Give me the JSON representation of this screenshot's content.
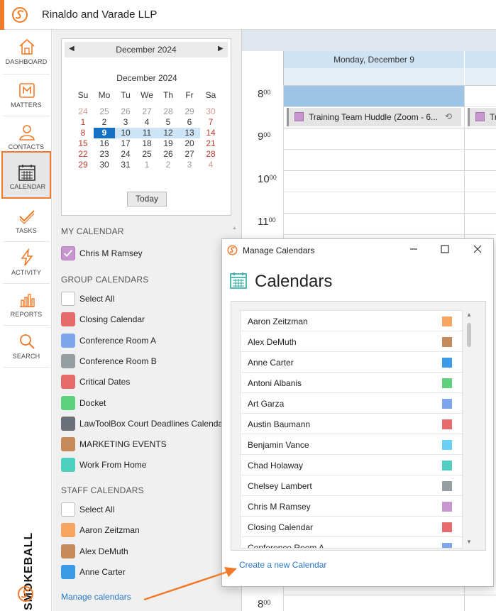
{
  "app": {
    "firm_name": "Rinaldo and Varade LLP",
    "brand_text": "SMOKEBALL",
    "accent_color": "#f07a28",
    "link_color": "#2a77c9"
  },
  "nav": {
    "items": [
      {
        "label": "DASHBOARD",
        "icon": "home-icon"
      },
      {
        "label": "MATTERS",
        "icon": "matters-icon"
      },
      {
        "label": "CONTACTS",
        "icon": "contacts-icon"
      },
      {
        "label": "CALENDAR",
        "icon": "calendar-icon",
        "active": true
      },
      {
        "label": "TASKS",
        "icon": "tasks-icon"
      },
      {
        "label": "ACTIVITY",
        "icon": "activity-icon"
      },
      {
        "label": "REPORTS",
        "icon": "reports-icon"
      },
      {
        "label": "SEARCH",
        "icon": "search-icon"
      }
    ]
  },
  "mini_calendar": {
    "header_title": "December 2024",
    "month_title": "December 2024",
    "weekdays": [
      "Su",
      "Mo",
      "Tu",
      "We",
      "Th",
      "Fr",
      "Sa"
    ],
    "weeks": [
      [
        "24",
        "25",
        "26",
        "27",
        "28",
        "29",
        "30"
      ],
      [
        "1",
        "2",
        "3",
        "4",
        "5",
        "6",
        "7"
      ],
      [
        "8",
        "9",
        "10",
        "11",
        "12",
        "13",
        "14"
      ],
      [
        "15",
        "16",
        "17",
        "18",
        "19",
        "20",
        "21"
      ],
      [
        "22",
        "23",
        "24",
        "25",
        "26",
        "27",
        "28"
      ],
      [
        "29",
        "30",
        "31",
        "1",
        "2",
        "3",
        "4"
      ]
    ],
    "selected_day": "9",
    "today_button": "Today"
  },
  "sections": {
    "my_calendar": "MY CALENDAR",
    "group_calendars": "GROUP CALENDARS",
    "staff_calendars": "STAFF CALENDARS"
  },
  "my_calendar": [
    {
      "name": "Chris M Ramsey",
      "color": "#c995d0",
      "checked": true
    }
  ],
  "group_calendars": [
    {
      "name": "Select All",
      "color": "#ffffff"
    },
    {
      "name": "Closing Calendar",
      "color": "#e56b6b"
    },
    {
      "name": "Conference Room A",
      "color": "#7ea6ec"
    },
    {
      "name": "Conference Room B",
      "color": "#959fa3"
    },
    {
      "name": "Critical Dates",
      "color": "#e56b6b"
    },
    {
      "name": "Docket",
      "color": "#5fd07e"
    },
    {
      "name": "LawToolBox Court Deadlines Calendar",
      "color": "#6b6f78"
    },
    {
      "name": "MARKETING EVENTS",
      "color": "#c68a5a"
    },
    {
      "name": "Work From Home",
      "color": "#4ecfc0"
    }
  ],
  "staff_calendars": [
    {
      "name": "Select All",
      "color": "#ffffff"
    },
    {
      "name": "Aaron Zeitzman",
      "color": "#f7a561"
    },
    {
      "name": "Alex DeMuth",
      "color": "#c68a5a"
    },
    {
      "name": "Anne Carter",
      "color": "#3c9be8"
    }
  ],
  "manage_link": "Manage calendars",
  "calendar_view": {
    "day_header": "Monday, December 9",
    "hours": [
      {
        "h": "8",
        "m": "00"
      },
      {
        "h": "9",
        "m": "00"
      },
      {
        "h": "10",
        "m": "00"
      },
      {
        "h": "11",
        "m": "00"
      }
    ],
    "bottom_hour": {
      "h": "8",
      "m": "00"
    },
    "event_title": "Training Team Huddle  (Zoom - 6...",
    "event_title_2": "Tr"
  },
  "dialog": {
    "window_title": "Manage Calendars",
    "heading": "Calendars",
    "calendars": [
      {
        "name": "Aaron Zeitzman",
        "color": "#f7a561"
      },
      {
        "name": "Alex DeMuth",
        "color": "#c68a5a"
      },
      {
        "name": "Anne Carter",
        "color": "#3c9be8"
      },
      {
        "name": "Antoni Albanis",
        "color": "#5fd07e"
      },
      {
        "name": "Art Garza",
        "color": "#7ea6ec"
      },
      {
        "name": "Austin Baumann",
        "color": "#e56b6b"
      },
      {
        "name": "Benjamin Vance",
        "color": "#69cff5"
      },
      {
        "name": "Chad Holaway",
        "color": "#4ecfc0"
      },
      {
        "name": "Chelsey Lambert",
        "color": "#959fa3"
      },
      {
        "name": "Chris M Ramsey",
        "color": "#c995d0"
      },
      {
        "name": "Closing Calendar",
        "color": "#e56b6b"
      },
      {
        "name": "Conference Room A",
        "color": "#7ea6ec"
      }
    ],
    "create_link": "Create a new Calendar"
  }
}
